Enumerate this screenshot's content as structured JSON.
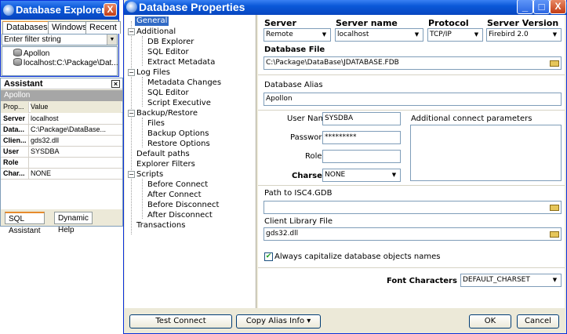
{
  "explorer": {
    "title": "Database Explorer",
    "close_glyph": "X",
    "tabs": [
      {
        "label": "Databases",
        "active": true
      },
      {
        "label": "Windows",
        "active": false
      },
      {
        "label": "Recent",
        "active": false
      }
    ],
    "filter_placeholder": "Enter filter string",
    "tree": [
      "Apollon",
      "localhost:C:\\Package\\Dat..."
    ]
  },
  "assistant": {
    "title": "Assistant",
    "close_glyph": "×",
    "subtitle": "Apollon",
    "header": {
      "key": "Prop...",
      "value": "Value"
    },
    "rows": [
      {
        "key": "Server",
        "value": "localhost"
      },
      {
        "key": "Data...",
        "value": "C:\\Package\\DataBase..."
      },
      {
        "key": "Clien...",
        "value": "gds32.dll"
      },
      {
        "key": "User",
        "value": "SYSDBA"
      },
      {
        "key": "Role",
        "value": ""
      },
      {
        "key": "Char...",
        "value": "NONE"
      }
    ],
    "tabs": [
      "SQL Assistant",
      "Dynamic Help"
    ]
  },
  "dialog": {
    "title": "Database Properties",
    "window_buttons": {
      "minimize": "_",
      "maximize": "□",
      "close": "X"
    },
    "nav": {
      "general": "General",
      "additional": "Additional",
      "db_explorer": "DB Explorer",
      "sql_editor": "SQL Editor",
      "extract_metadata": "Extract Metadata",
      "log_files": "Log Files",
      "metadata_changes": "Metadata Changes",
      "sql_editor_log": "SQL Editor",
      "script_executive": "Script Executive",
      "backup_restore": "Backup/Restore",
      "files": "Files",
      "backup_options": "Backup Options",
      "restore_options": "Restore Options",
      "default_paths": "Default paths",
      "explorer_filters": "Explorer Filters",
      "scripts": "Scripts",
      "before_connect": "Before Connect",
      "after_connect": "After Connect",
      "before_disconnect": "Before Disconnect",
      "after_disconnect": "After Disconnect",
      "transactions": "Transactions"
    },
    "tree_glyphs": {
      "collapse": "−"
    },
    "general": {
      "server_label": "Server",
      "server_value": "Remote",
      "server_name_label": "Server name",
      "server_name_value": "localhost",
      "protocol_label": "Protocol",
      "protocol_value": "TCP/IP",
      "server_version_label": "Server Version",
      "server_version_value": "Firebird 2.0",
      "database_file_label": "Database File",
      "database_file_value": "C:\\Package\\DataBase\\JDATABASE.FDB",
      "alias_label": "Database Alias",
      "alias_value": "Apollon",
      "user_name_label": "User Name",
      "user_name_value": "SYSDBA",
      "password_label": "Password",
      "password_value": "*********",
      "role_label": "Role",
      "role_value": "",
      "charset_label": "Charset",
      "charset_value": "NONE",
      "additional_params_label": "Additional connect parameters",
      "isc4_label": "Path to ISC4.GDB",
      "isc4_value": "",
      "client_lib_label": "Client Library File",
      "client_lib_value": "gds32.dll",
      "capitalize_label": "Always capitalize database objects names",
      "capitalize_checked": true,
      "font_charset_label": "Font Characters Set",
      "font_charset_value": "DEFAULT_CHARSET"
    },
    "dropdown_glyph": "▼",
    "check_glyph": "✔",
    "buttons": {
      "test_connect": "Test Connect",
      "copy_alias": "Copy Alias Info ▾",
      "ok": "OK",
      "cancel": "Cancel"
    }
  }
}
